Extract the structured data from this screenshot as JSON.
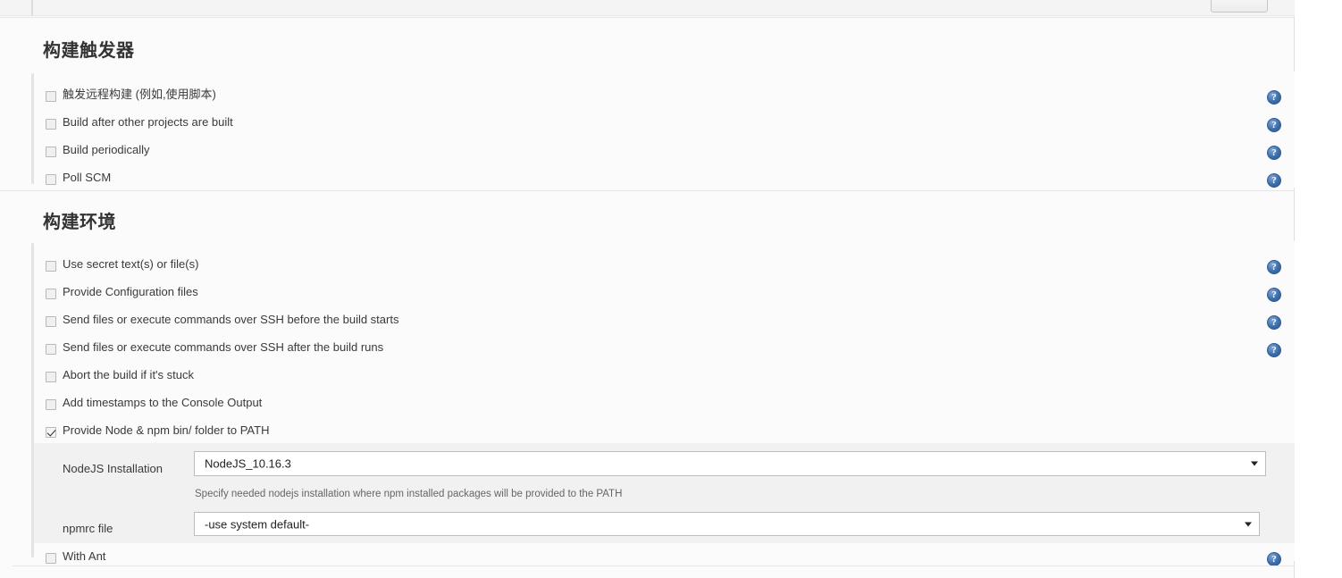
{
  "top": {
    "cut_button_label": ""
  },
  "sections": [
    {
      "id": "build-triggers",
      "title": "构建触发器",
      "items": [
        {
          "label": "触发远程构建 (例如,使用脚本)",
          "checked": false,
          "help": true,
          "help_glyph": "?"
        },
        {
          "label": "Build after other projects are built",
          "checked": false,
          "help": true,
          "help_glyph": "?"
        },
        {
          "label": "Build periodically",
          "checked": false,
          "help": true,
          "help_glyph": "?"
        },
        {
          "label": "Poll SCM",
          "checked": false,
          "help": true,
          "help_glyph": "?"
        }
      ]
    },
    {
      "id": "build-environment",
      "title": "构建环境",
      "items": [
        {
          "label": "Use secret text(s) or file(s)",
          "checked": false,
          "help": true,
          "help_glyph": "?"
        },
        {
          "label": "Provide Configuration files",
          "checked": false,
          "help": true,
          "help_glyph": "?"
        },
        {
          "label": "Send files or execute commands over SSH before the build starts",
          "checked": false,
          "help": true,
          "help_glyph": "?"
        },
        {
          "label": "Send files or execute commands over SSH after the build runs",
          "checked": false,
          "help": true,
          "help_glyph": "?"
        },
        {
          "label": "Abort the build if it's stuck",
          "checked": false,
          "help": false,
          "help_glyph": "?"
        },
        {
          "label": "Add timestamps to the Console Output",
          "checked": false,
          "help": false,
          "help_glyph": "?"
        },
        {
          "label": "Provide Node & npm bin/ folder to PATH",
          "checked": true,
          "help": false,
          "help_glyph": "?"
        },
        {
          "label": "With Ant",
          "checked": false,
          "help": true,
          "help_glyph": "?"
        }
      ]
    }
  ],
  "nodejs_config": {
    "installation": {
      "label": "NodeJS Installation",
      "value": "NodeJS_10.16.3",
      "help_text": "Specify needed nodejs installation where npm installed packages will be provided to the PATH",
      "options": [
        "NodeJS_10.16.3"
      ]
    },
    "npmrc": {
      "label": "npmrc file",
      "value": "-use system default-",
      "options": [
        "-use system default-"
      ]
    }
  },
  "colors": {
    "page_bg": "#fbfbfb",
    "nested_bg": "#f1f1f1",
    "help_icon": "#3e6ea8",
    "text": "#3a3a3a"
  }
}
